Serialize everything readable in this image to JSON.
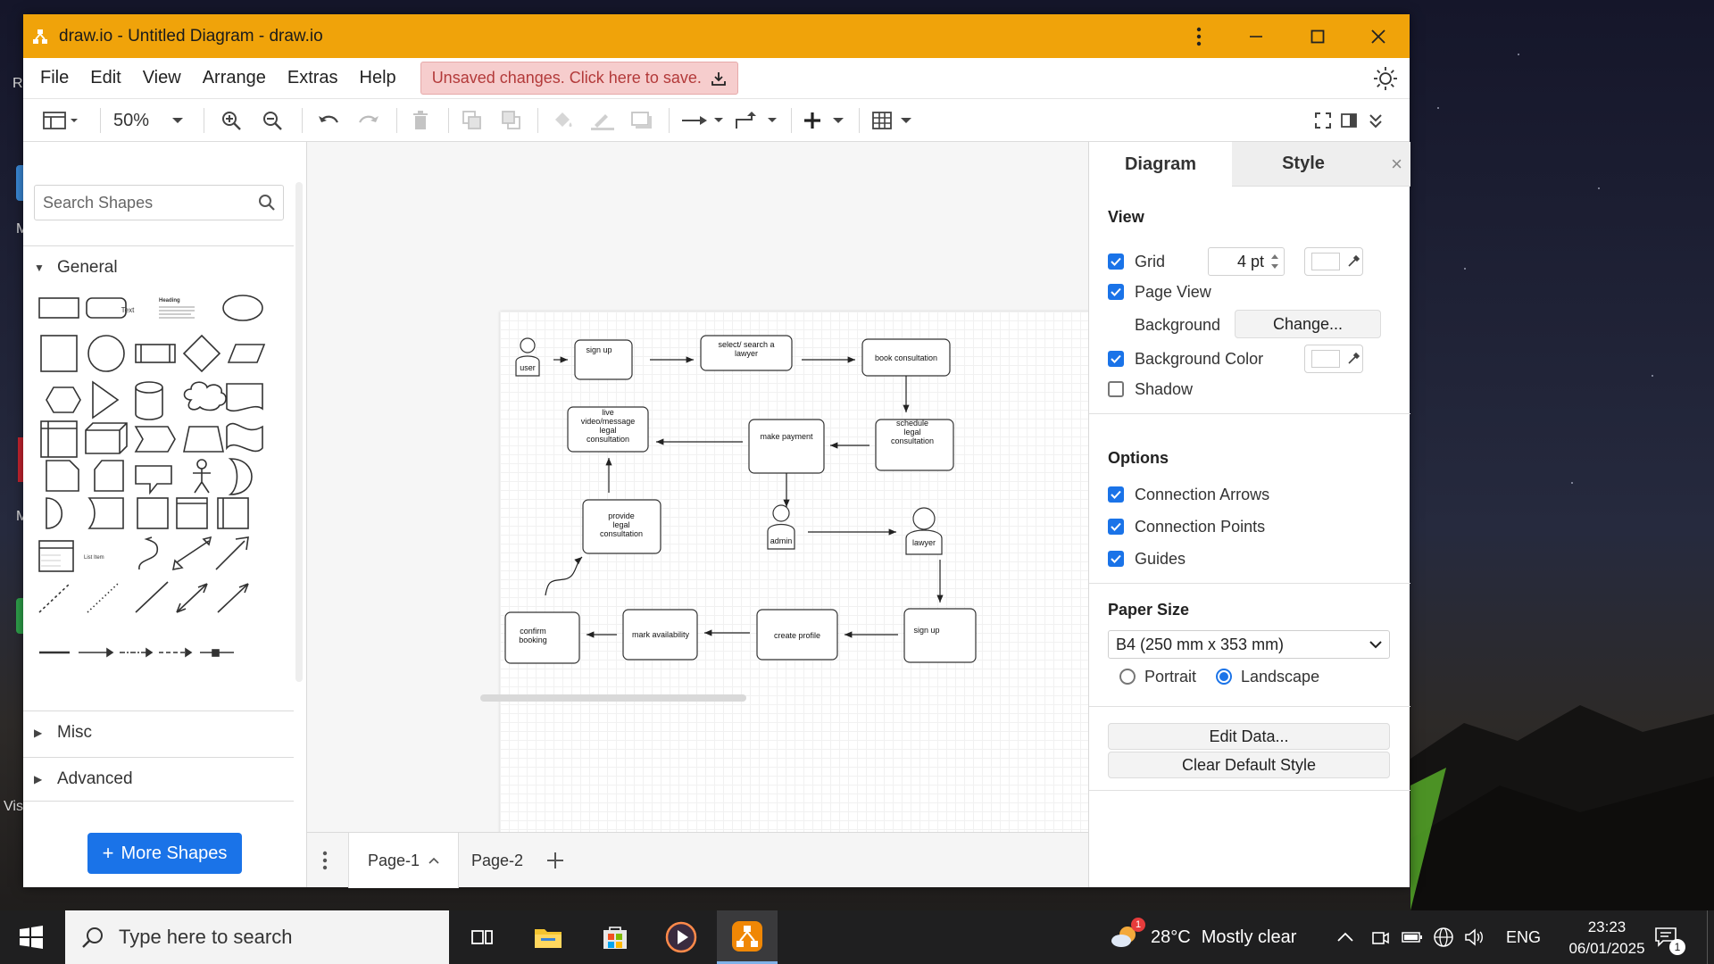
{
  "window": {
    "title": "draw.io - Untitled Diagram - draw.io"
  },
  "menu": {
    "items": [
      "File",
      "Edit",
      "View",
      "Arrange",
      "Extras",
      "Help"
    ],
    "unsaved_notice": "Unsaved changes. Click here to save."
  },
  "toolbar": {
    "zoom": "50%"
  },
  "left_panel": {
    "search_placeholder": "Search Shapes",
    "sections": {
      "general": "General",
      "misc": "Misc",
      "advanced": "Advanced"
    },
    "shape_text_labels": {
      "text": "Text",
      "heading": "Heading",
      "list_item": "List Item"
    },
    "more_shapes": "More Shapes"
  },
  "diagram": {
    "nodes": {
      "user": "user",
      "signup_top": "sign up",
      "select_lawyer_1": "select/ search a",
      "select_lawyer_2": "lawyer",
      "book": "book consultation",
      "live_1": "live",
      "live_2": "video/message",
      "live_3": "legal",
      "live_4": "consultation",
      "make_payment": "make payment",
      "schedule_1": "schedule",
      "schedule_2": "legal",
      "schedule_3": "consultation",
      "provide_1": "provide",
      "provide_2": "legal",
      "provide_3": "consultation",
      "admin": "admin",
      "lawyer": "lawyer",
      "confirm_1": "confirm",
      "confirm_2": "booking",
      "mark": "mark availability",
      "create_profile": "create profile",
      "signup_bottom": "sign up"
    }
  },
  "pages": {
    "page1": "Page-1",
    "page2": "Page-2"
  },
  "right_panel": {
    "tabs": {
      "diagram": "Diagram",
      "style": "Style"
    },
    "view": {
      "heading": "View",
      "grid": "Grid",
      "grid_size": "4 pt",
      "page_view": "Page View",
      "background": "Background",
      "change_btn": "Change...",
      "background_color": "Background Color",
      "shadow": "Shadow"
    },
    "options": {
      "heading": "Options",
      "connection_arrows": "Connection Arrows",
      "connection_points": "Connection Points",
      "guides": "Guides"
    },
    "paper": {
      "heading": "Paper Size",
      "size": "B4 (250 mm x 353 mm)",
      "portrait": "Portrait",
      "landscape": "Landscape"
    },
    "buttons": {
      "edit_data": "Edit Data...",
      "clear_style": "Clear Default Style"
    }
  },
  "taskbar": {
    "search_placeholder": "Type here to search",
    "weather_badge": "1",
    "temperature": "28°C",
    "weather": "Mostly clear",
    "language": "ENG",
    "time": "23:23",
    "date": "06/01/2025",
    "notification_count": "1"
  },
  "desktop": {
    "icon_labels": [
      "R",
      "M",
      "M",
      "Vis"
    ]
  },
  "colors": {
    "titlebar": "#f0a30a",
    "accent": "#1a73e8",
    "unsaved_bg": "#f6cdcd"
  }
}
